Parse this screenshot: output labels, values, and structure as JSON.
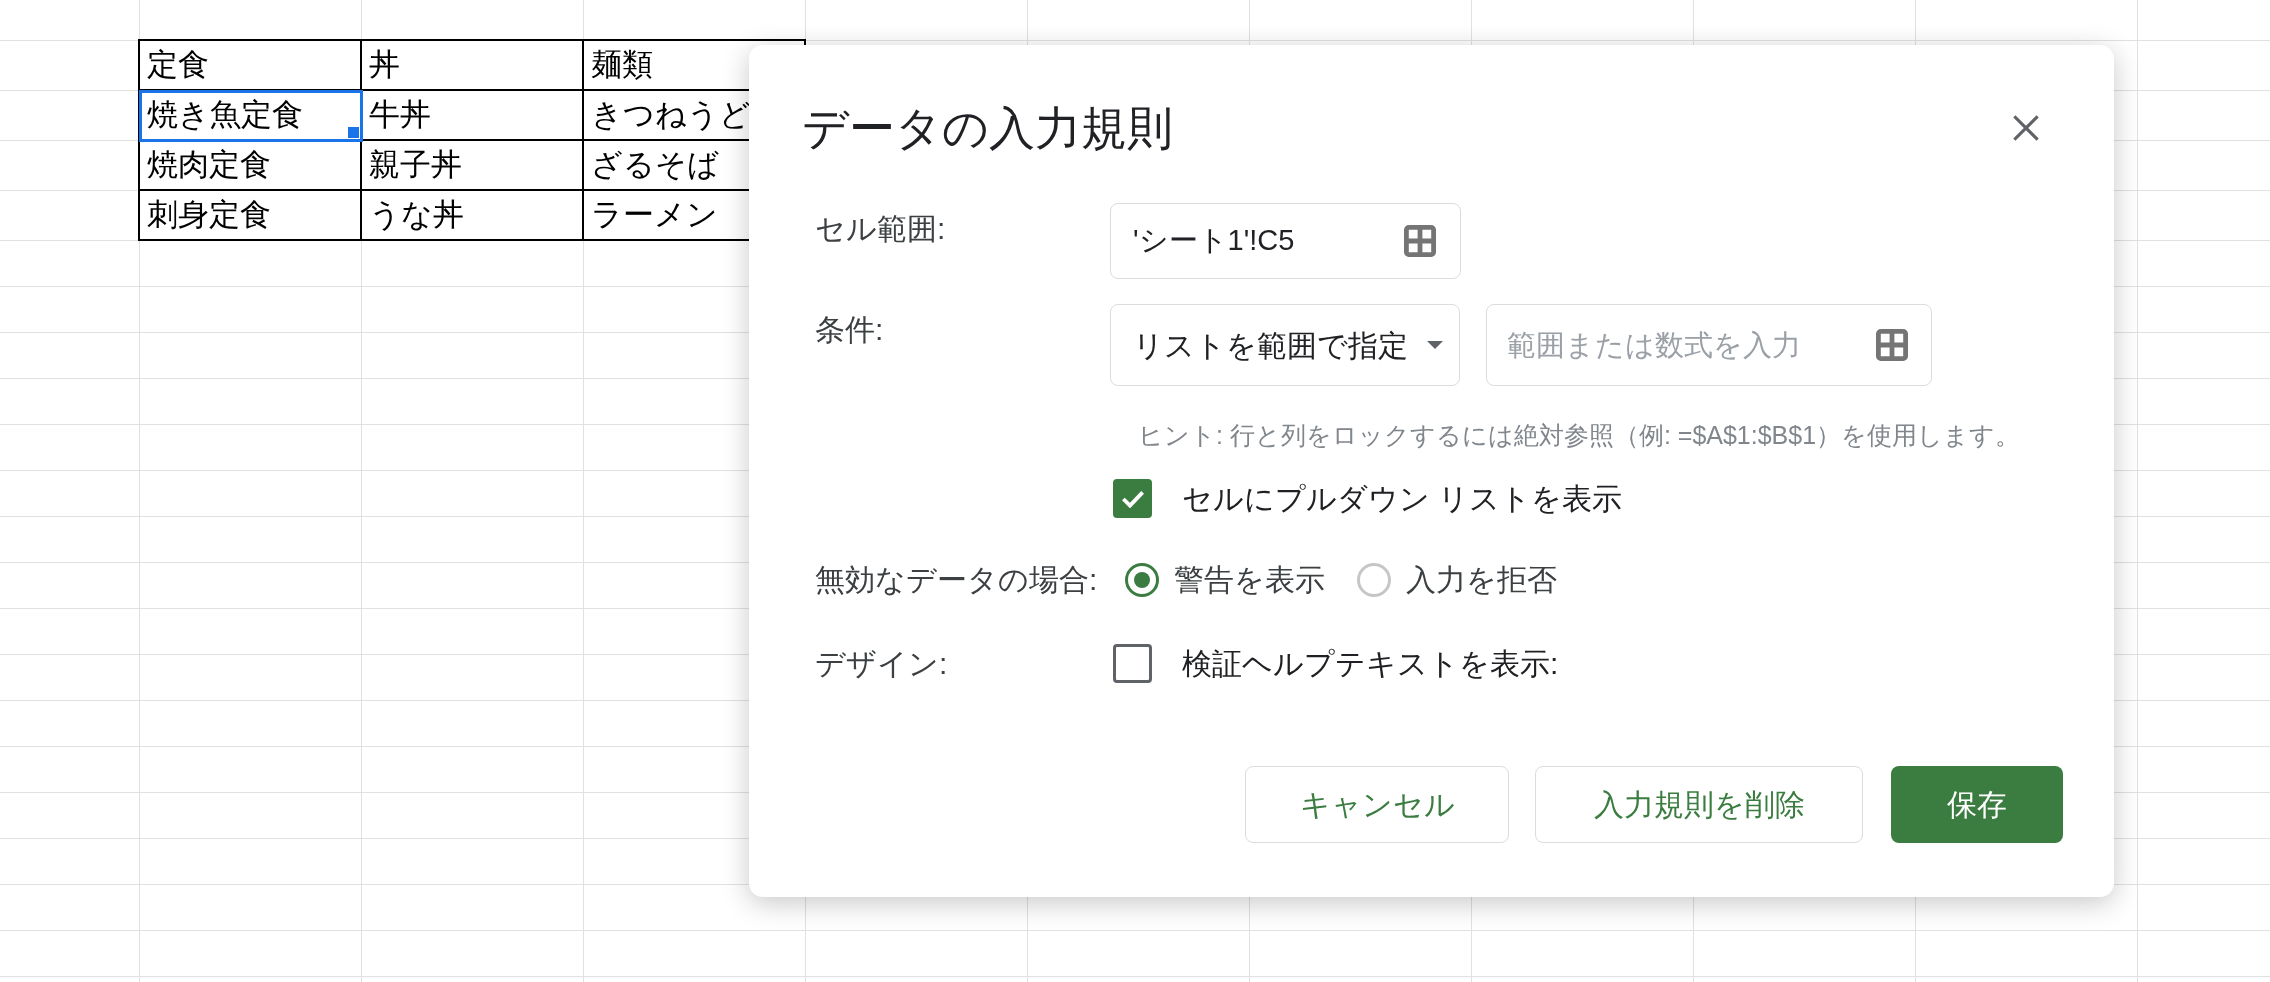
{
  "sheet": {
    "rows": [
      [
        {
          "text": "定食",
          "selected": false
        },
        {
          "text": "丼",
          "selected": false
        },
        {
          "text": "麺類",
          "selected": false
        }
      ],
      [
        {
          "text": "焼き魚定食",
          "selected": true
        },
        {
          "text": "牛丼",
          "selected": false
        },
        {
          "text": "きつねうど",
          "selected": false
        }
      ],
      [
        {
          "text": "焼肉定食",
          "selected": false
        },
        {
          "text": "親子丼",
          "selected": false
        },
        {
          "text": "ざるそば",
          "selected": false
        }
      ],
      [
        {
          "text": "刺身定食",
          "selected": false
        },
        {
          "text": "うな丼",
          "selected": false
        },
        {
          "text": "ラーメン",
          "selected": false
        }
      ]
    ]
  },
  "dialog": {
    "title": "データの入力規則",
    "cell_range": {
      "label": "セル範囲:",
      "value": "'シート1'!C5"
    },
    "criteria": {
      "label": "条件:",
      "dropdown": "リストを範囲で指定",
      "input": {
        "placeholder": "範囲または数式を入力"
      },
      "hint": "ヒント: 行と列をロックするには絶対参照（例: =$A$1:$B$1）を使用します。"
    },
    "show_dropdown": {
      "label": "セルにプルダウン リストを表示",
      "checked": true
    },
    "invalid_data": {
      "label": "無効なデータの場合:",
      "options": [
        {
          "label": "警告を表示",
          "selected": true
        },
        {
          "label": "入力を拒否",
          "selected": false
        }
      ]
    },
    "appearance": {
      "label": "デザイン:",
      "help_text": {
        "label": "検証ヘルプテキストを表示:",
        "checked": false
      }
    },
    "buttons": [
      {
        "label": "キャンセル",
        "kind": "secondary"
      },
      {
        "label": "入力規則を削除",
        "kind": "secondary"
      },
      {
        "label": "保存",
        "kind": "primary"
      }
    ]
  }
}
